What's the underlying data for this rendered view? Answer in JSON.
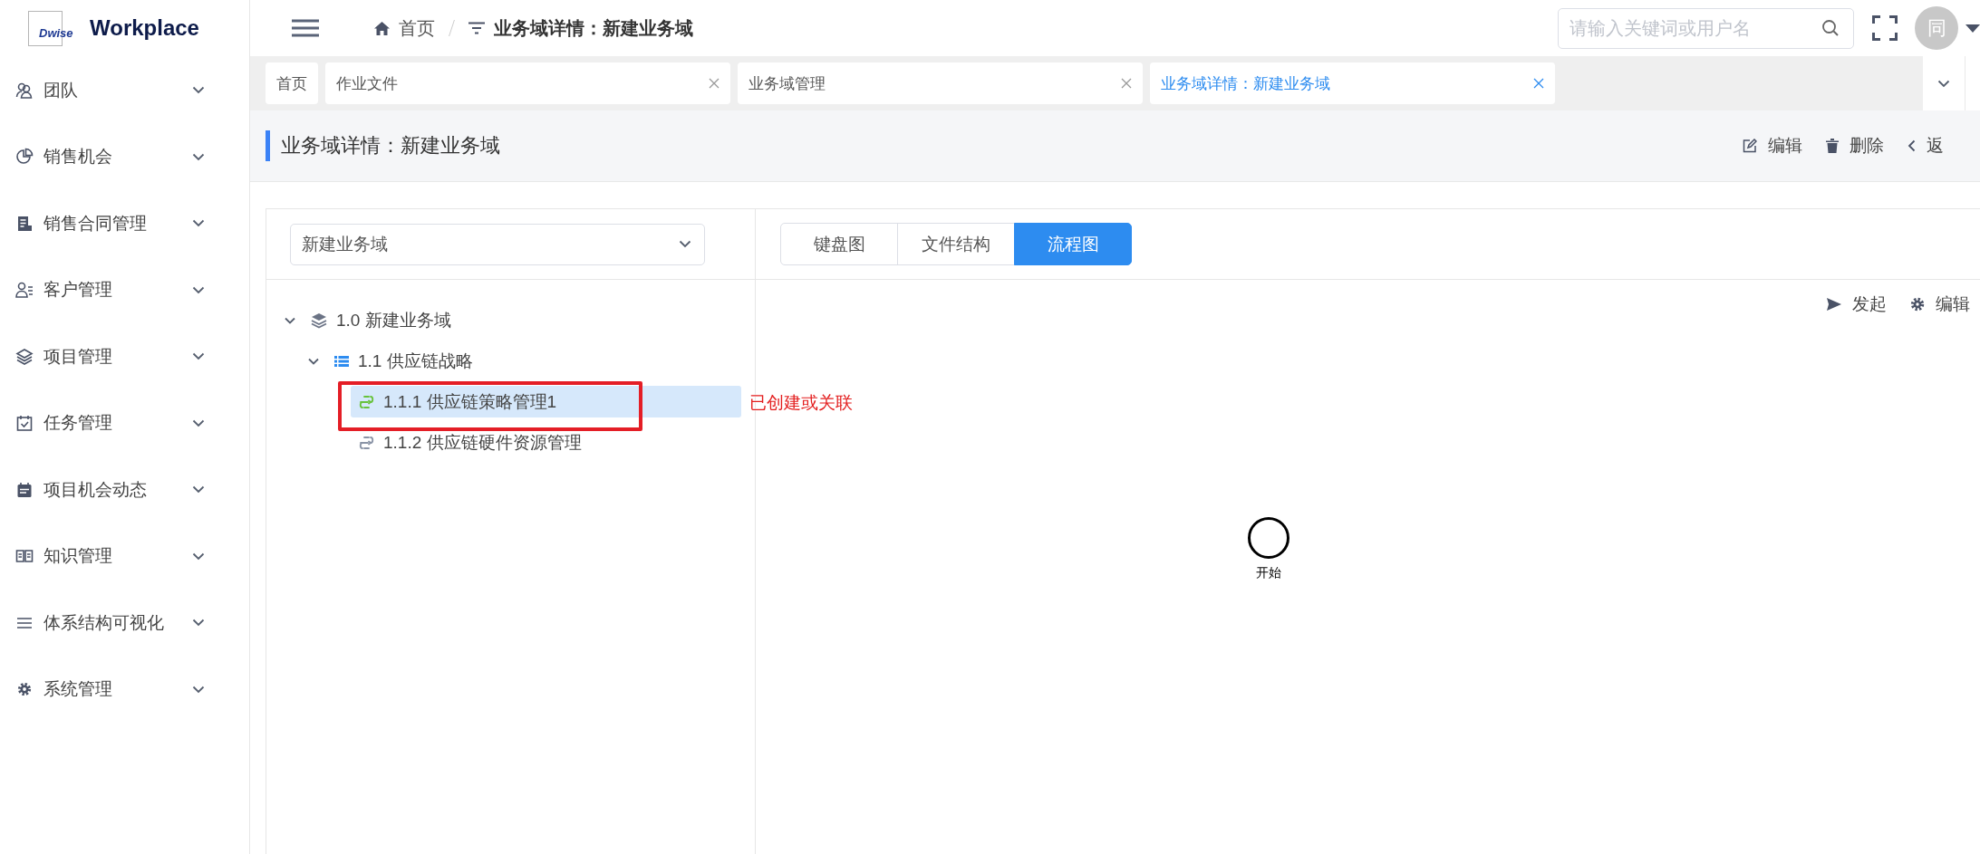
{
  "brand": {
    "logo": "Dwise",
    "name": "Workplace"
  },
  "sidebar": {
    "items": [
      {
        "label": "团队"
      },
      {
        "label": "销售机会"
      },
      {
        "label": "销售合同管理"
      },
      {
        "label": "客户管理"
      },
      {
        "label": "项目管理"
      },
      {
        "label": "任务管理"
      },
      {
        "label": "项目机会动态"
      },
      {
        "label": "知识管理"
      },
      {
        "label": "体系结构可视化"
      },
      {
        "label": "系统管理"
      }
    ]
  },
  "breadcrumb": [
    {
      "label": "首页"
    },
    {
      "label": "业务域详情：新建业务域"
    }
  ],
  "search": {
    "placeholder": "请输入关键词或用户名"
  },
  "user": {
    "avatar": "同"
  },
  "tabs": [
    {
      "label": "首页",
      "selected": false,
      "closable": false
    },
    {
      "label": "作业文件",
      "selected": false,
      "closable": true
    },
    {
      "label": "业务域管理",
      "selected": false,
      "closable": true
    },
    {
      "label": "业务域详情：新建业务域",
      "selected": true,
      "closable": true
    }
  ],
  "page": {
    "title": "业务域详情：新建业务域",
    "actions": [
      "编辑",
      "删除",
      "返"
    ]
  },
  "domain_select": {
    "value": "新建业务域"
  },
  "view_tabs": [
    {
      "label": "键盘图",
      "selected": false
    },
    {
      "label": "文件结构",
      "selected": false
    },
    {
      "label": "流程图",
      "selected": true
    }
  ],
  "tree": [
    {
      "label": "1.0 新建业务域",
      "selected": false,
      "expanded": true,
      "children": [
        {
          "label": "1.1 供应链战略",
          "selected": false,
          "expanded": true,
          "children": [
            {
              "label": "1.1.1 供应链策略管理1",
              "selected": true,
              "linked": true,
              "note": "已创建或关联"
            },
            {
              "label": "1.1.2 供应链硬件资源管理",
              "selected": false,
              "linked": false
            }
          ]
        }
      ]
    }
  ],
  "flow_toolbar": [
    "发起",
    "编辑"
  ],
  "flow": {
    "nodes": [
      {
        "kind": "start",
        "label": "开始"
      }
    ]
  }
}
